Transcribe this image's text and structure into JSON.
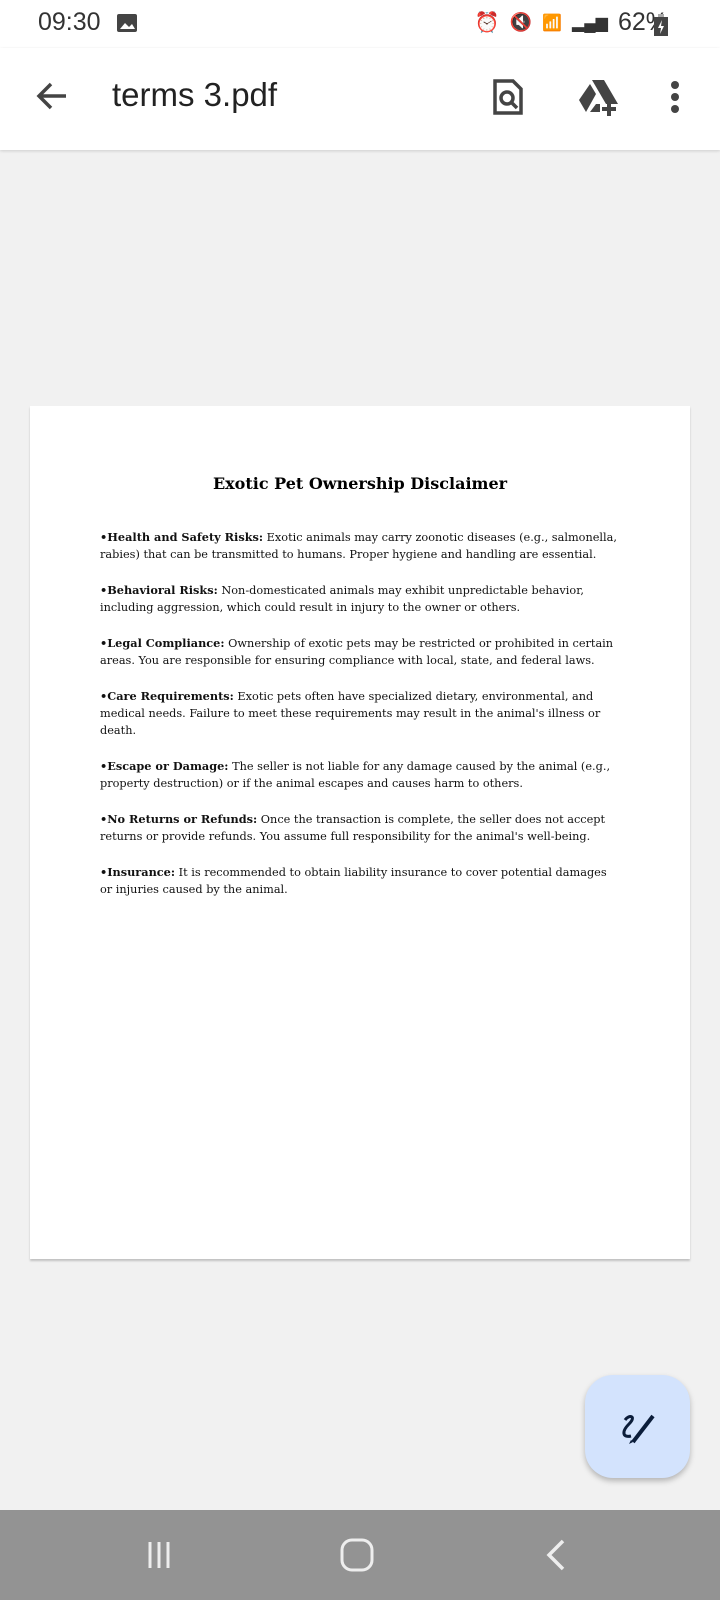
{
  "status": {
    "time": "09:30",
    "battery": "62%"
  },
  "appbar": {
    "title": "terms 3.pdf"
  },
  "document": {
    "title": "Exotic Pet Ownership Disclaimer",
    "items": [
      {
        "heading": "•Health and Safety Risks:",
        "text": " Exotic animals may carry zoonotic diseases (e.g., salmonella, rabies) that can be transmitted to humans. Proper hygiene and handling are essential."
      },
      {
        "heading": "•Behavioral Risks:",
        "text": " Non-domesticated animals may exhibit unpredictable behavior, including aggression, which could result in injury to the owner or others."
      },
      {
        "heading": "•Legal Compliance:",
        "text": " Ownership of exotic pets may be restricted or prohibited in certain areas. You are responsible for ensuring compliance with local, state, and federal laws."
      },
      {
        "heading": "•Care Requirements:",
        "text": " Exotic pets often have specialized dietary, environmental, and medical needs. Failure to meet these requirements may result in the animal's illness or death."
      },
      {
        "heading": "•Escape or Damage:",
        "text": " The seller is not liable for any damage caused by the animal (e.g., property destruction) or if the animal escapes and causes harm to others."
      },
      {
        "heading": "•No Returns or Refunds:",
        "text": " Once the transaction is complete, the seller does not accept returns or provide refunds. You assume full responsibility for the animal's well-being."
      },
      {
        "heading": "•Insurance:",
        "text": " It is recommended to obtain liability insurance to cover potential damages or injuries caused by the animal."
      }
    ]
  }
}
